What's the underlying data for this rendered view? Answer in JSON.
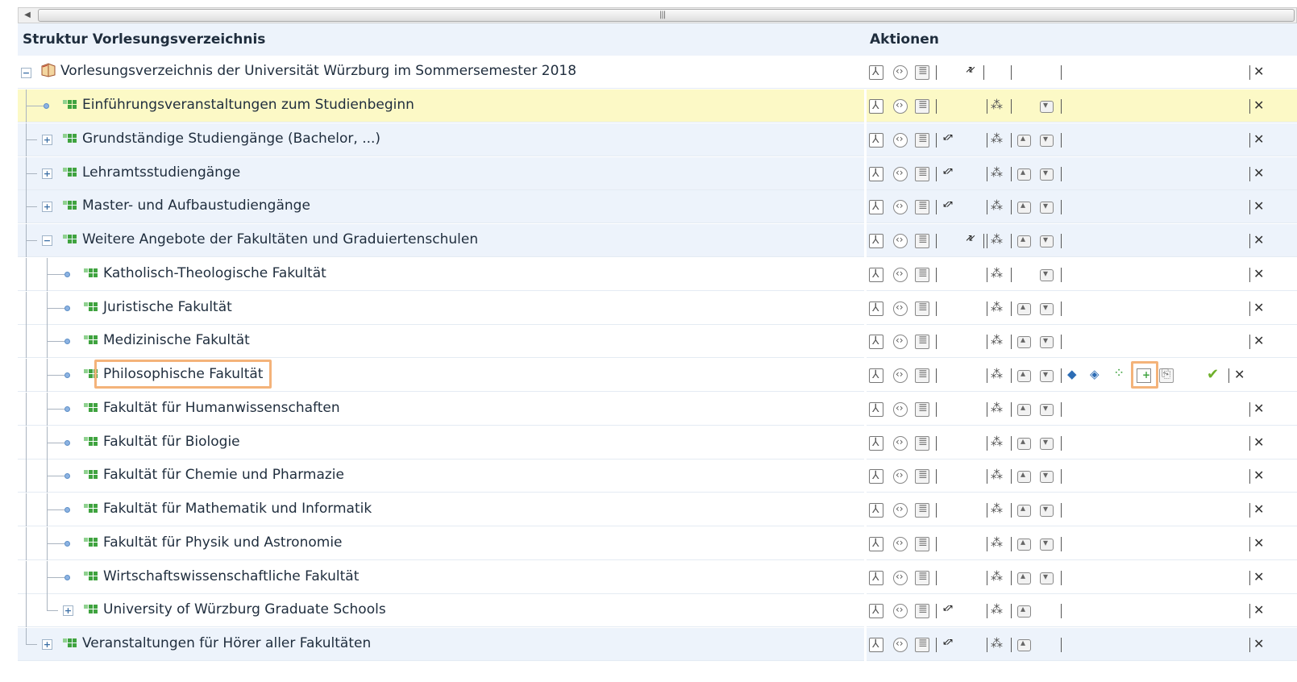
{
  "header": {
    "col_structure": "Struktur Vorlesungsverzeichnis",
    "col_actions": "Aktionen"
  },
  "root": {
    "label": "Vorlesungsverzeichnis der Universität Würzburg im Sommersemester 2018"
  },
  "rows": [
    {
      "label": "Einführungsveranstaltungen zum Studienbeginn"
    },
    {
      "label": "Grundständige Studiengänge (Bachelor, ...)"
    },
    {
      "label": "Lehramtsstudiengänge"
    },
    {
      "label": "Master- und Aufbaustudiengänge"
    },
    {
      "label": "Weitere Angebote der Fakultäten und Graduiertenschulen"
    },
    {
      "label": "Katholisch-Theologische Fakultät"
    },
    {
      "label": "Juristische Fakultät"
    },
    {
      "label": "Medizinische Fakultät"
    },
    {
      "label": "Philosophische Fakultät"
    },
    {
      "label": "Fakultät für Humanwissenschaften"
    },
    {
      "label": "Fakultät für Biologie"
    },
    {
      "label": "Fakultät für Chemie und Pharmazie"
    },
    {
      "label": "Fakultät für Mathematik und Informatik"
    },
    {
      "label": "Fakultät für Physik und Astronomie"
    },
    {
      "label": "Wirtschaftswissenschaftliche Fakultät"
    },
    {
      "label": "University of Würzburg Graduate Schools"
    },
    {
      "label": "Veranstaltungen für Hörer aller Fakultäten"
    }
  ],
  "colors": {
    "row_alt": "#edf3fb",
    "row_highlight": "#fcf9c6",
    "focus_outline": "#f4b37a",
    "node_icon": "#3fa33f"
  }
}
